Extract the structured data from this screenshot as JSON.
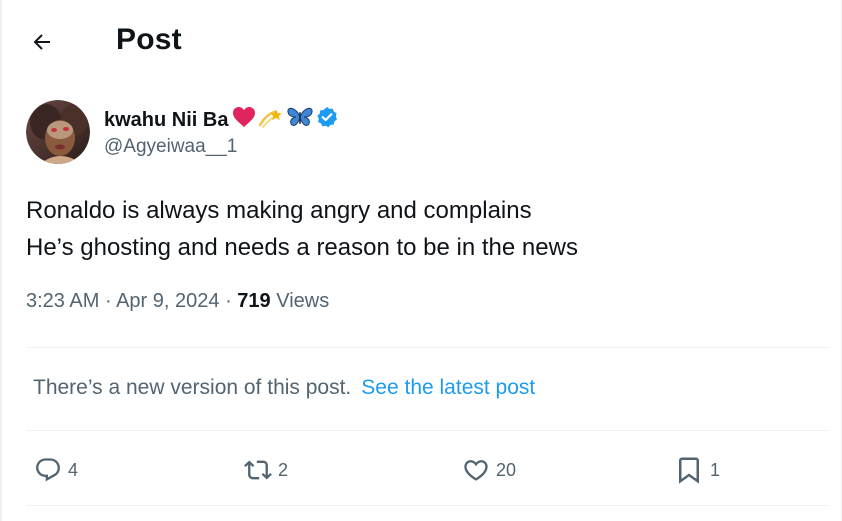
{
  "header": {
    "title": "Post",
    "back_icon": "arrow-left-icon"
  },
  "author": {
    "display_name": "kwahu Nii Ba",
    "name_emojis": [
      "heart-emoji",
      "shooting-star-emoji",
      "butterfly-emoji"
    ],
    "verified_icon": "verified-badge-icon",
    "handle": "@Agyeiwaa__1"
  },
  "post": {
    "lines": [
      "Ronaldo is always making angry and complains",
      "He’s ghosting and needs a reason to be in the news"
    ]
  },
  "meta": {
    "time": "3:23 AM",
    "separator": "·",
    "date": "Apr 9, 2024",
    "views_count": "719",
    "views_label": "Views"
  },
  "notice": {
    "text": "There’s a new version of this post.",
    "link": "See the latest post"
  },
  "actions": {
    "reply": {
      "icon": "reply-icon",
      "count": "4"
    },
    "repost": {
      "icon": "repost-icon",
      "count": "2"
    },
    "like": {
      "icon": "heart-icon",
      "count": "20"
    },
    "bookmark": {
      "icon": "bookmark-icon",
      "count": "1"
    }
  },
  "colors": {
    "text": "#0f1419",
    "muted": "#536471",
    "link": "#1d9bf0",
    "verified": "#1d9bf0",
    "heart": "#e0245e"
  }
}
